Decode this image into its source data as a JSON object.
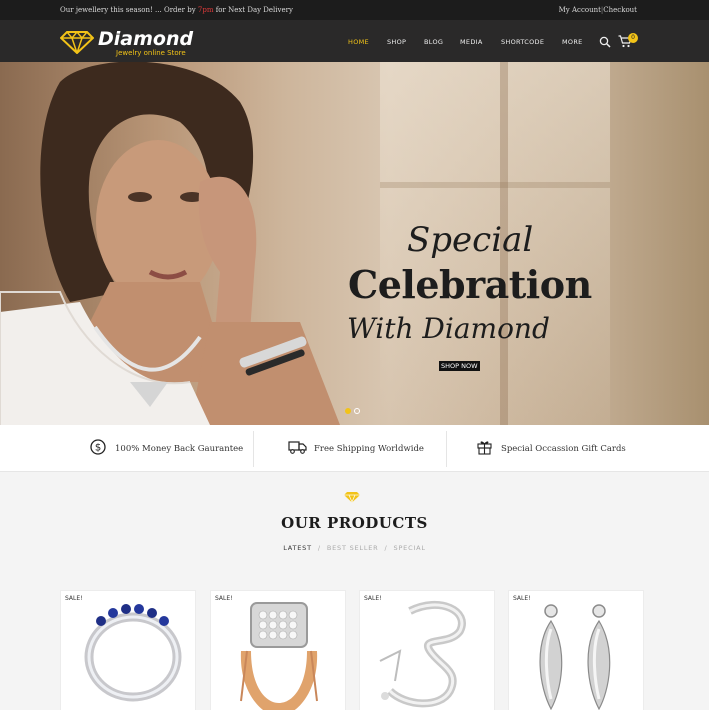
{
  "topbar": {
    "promo_prefix": "Our jewellery this season! ... Order by ",
    "promo_highlight": "7pm",
    "promo_suffix": " for Next Day Delivery",
    "my_account": "My Account",
    "checkout": "Checkout"
  },
  "header": {
    "logo_name": "Diamond",
    "logo_tagline": "Jewelry online Store",
    "nav": [
      "HOME",
      "SHOP",
      "BLOG",
      "MEDIA",
      "SHORTCODE",
      "MORE"
    ],
    "active_nav": "HOME",
    "cart_count": "0",
    "accent_color": "#f2c318"
  },
  "hero": {
    "line1": "Special",
    "line2": "Celebration",
    "line3": "With Diamond",
    "cta": "SHOP NOW",
    "slides": 2,
    "active_slide": 1
  },
  "features": [
    {
      "icon": "dollar-circle-icon",
      "label": "100% Money Back Gaurantee"
    },
    {
      "icon": "truck-icon",
      "label": "Free Shipping Worldwide"
    },
    {
      "icon": "gift-icon",
      "label": "Special Occassion Gift Cards"
    }
  ],
  "products_section": {
    "title": "OUR PRODUCTS",
    "filters": [
      "LATEST",
      "BEST SELLER",
      "SPECIAL"
    ],
    "active_filter": "LATEST"
  },
  "products": [
    {
      "badge": "SALE!",
      "icon": "sapphire-ring-icon"
    },
    {
      "badge": "SALE!",
      "icon": "gold-ring-icon"
    },
    {
      "badge": "SALE!",
      "icon": "silver-bracelet-icon"
    },
    {
      "badge": "SALE!",
      "icon": "earrings-icon"
    }
  ]
}
